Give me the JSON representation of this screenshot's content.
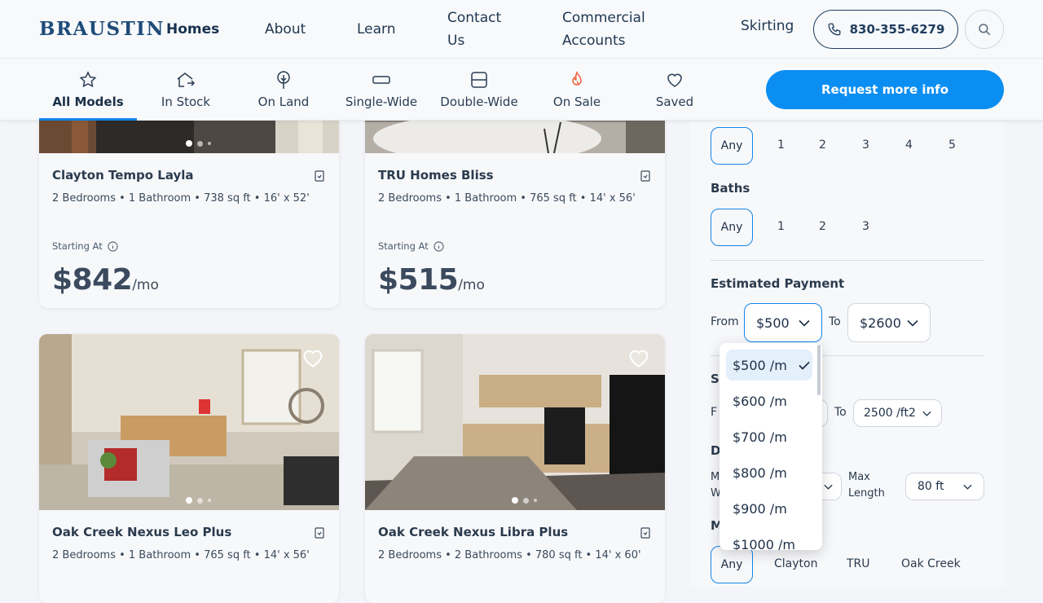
{
  "header": {
    "logo": "BRAUSTIN",
    "nav": [
      "Homes",
      "About",
      "Learn",
      "Contact Us",
      "Commercial Accounts"
    ],
    "skirting": "Skirting",
    "phone": "830-355-6279"
  },
  "categories": [
    {
      "label": "All Models",
      "icon": "star-icon",
      "active": true
    },
    {
      "label": "In Stock",
      "icon": "house-arrow-icon"
    },
    {
      "label": "On Land",
      "icon": "tree-icon"
    },
    {
      "label": "Single-Wide",
      "icon": "single-wide-icon"
    },
    {
      "label": "Double-Wide",
      "icon": "double-wide-icon"
    },
    {
      "label": "On Sale",
      "icon": "flame-icon"
    },
    {
      "label": "Saved",
      "icon": "heart-icon"
    }
  ],
  "request_label": "Request more info",
  "cards": [
    {
      "title": "Clayton Tempo Layla",
      "specs": "2 Bedrooms • 1 Bathroom • 738 sq ft • 16' x 52'",
      "starting": "Starting At",
      "price": "$842",
      "unit": "/mo"
    },
    {
      "title": "TRU Homes Bliss",
      "specs": "2 Bedrooms • 1 Bathroom • 765 sq ft • 14' x 56'",
      "starting": "Starting At",
      "price": "$515",
      "unit": "/mo"
    },
    {
      "title": "Oak Creek Nexus Leo Plus",
      "specs": "2 Bedrooms • 1 Bathroom • 765 sq ft • 14' x 56'"
    },
    {
      "title": "Oak Creek Nexus Libra Plus",
      "specs": "2 Bedrooms • 2 Bathrooms • 780 sq ft • 14' x 60'"
    }
  ],
  "filters": {
    "beds_options": [
      "Any",
      "1",
      "2",
      "3",
      "4",
      "5"
    ],
    "baths_label": "Baths",
    "baths_options": [
      "Any",
      "1",
      "2",
      "3"
    ],
    "payment_label": "Estimated Payment",
    "from_label": "From",
    "to_label": "To",
    "payment_from": "$500",
    "payment_to": "$2600",
    "size_label_partial": "S",
    "size_from_partial": "F",
    "size_to_label": "To",
    "size_to": "2500 /ft2",
    "dim_label_partial": "D",
    "min_width_partial": [
      "M",
      "W"
    ],
    "max_length_label": [
      "Max",
      "Length"
    ],
    "max_length": "80 ft",
    "maker_label_partial": "M",
    "maker_options": [
      "Any",
      "Clayton",
      "TRU",
      "Oak Creek"
    ]
  },
  "dropdown": {
    "options": [
      "$500 /m",
      "$600 /m",
      "$700 /m",
      "$800 /m",
      "$900 /m",
      "$1000 /m"
    ],
    "selected": "$500 /m"
  },
  "colors": {
    "accent": "#0b8ef2",
    "navy": "#1f3d5e"
  }
}
